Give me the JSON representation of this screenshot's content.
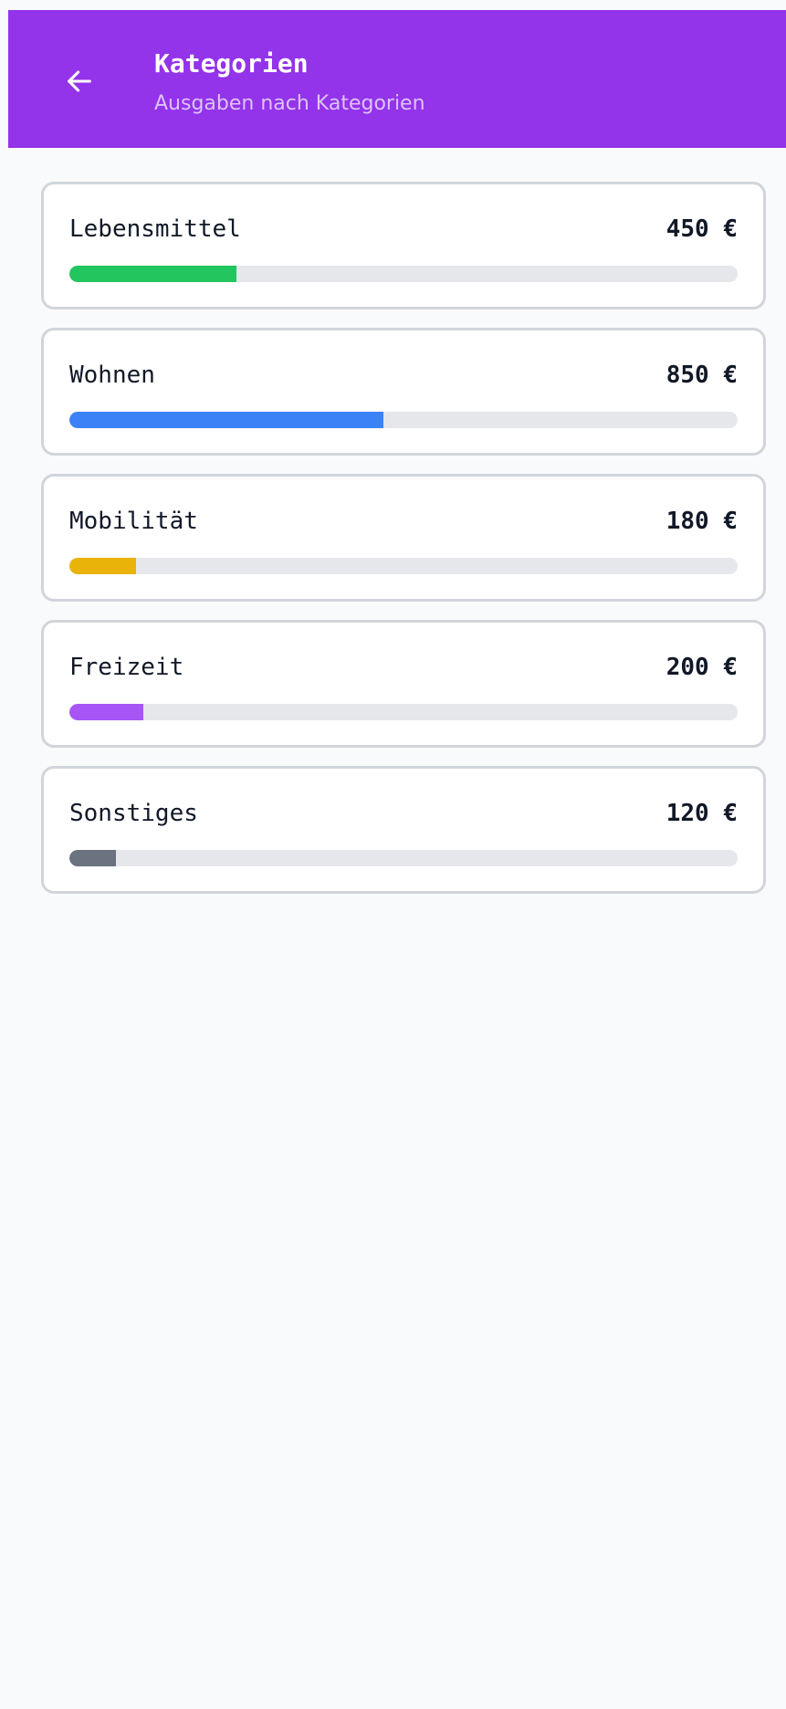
{
  "header": {
    "title": "Kategorien",
    "subtitle": "Ausgaben nach Kategorien",
    "back_icon": "arrow-left-icon"
  },
  "colors": {
    "header_bg": "#9333ea",
    "track": "#e5e7eb"
  },
  "categories": [
    {
      "name": "Lebensmittel",
      "amount": "450 €",
      "fill_percent": 25,
      "color": "#22c55e"
    },
    {
      "name": "Wohnen",
      "amount": "850 €",
      "fill_percent": 47,
      "color": "#3b82f6"
    },
    {
      "name": "Mobilität",
      "amount": "180 €",
      "fill_percent": 10,
      "color": "#eab308"
    },
    {
      "name": "Freizeit",
      "amount": "200 €",
      "fill_percent": 11,
      "color": "#a855f7"
    },
    {
      "name": "Sonstiges",
      "amount": "120 €",
      "fill_percent": 7,
      "color": "#6b7280"
    }
  ]
}
